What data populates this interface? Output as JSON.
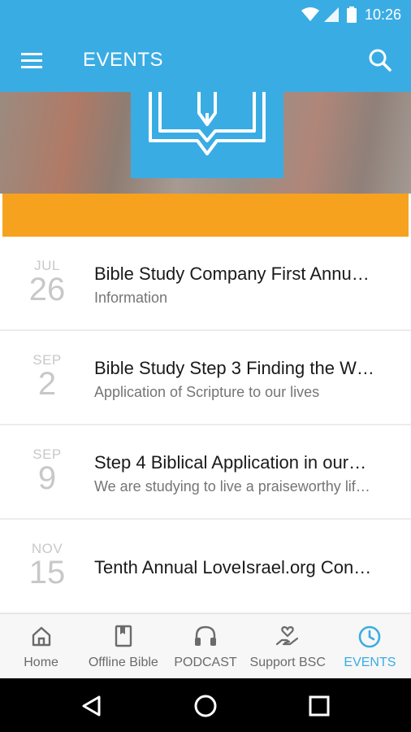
{
  "status_bar": {
    "time": "10:26"
  },
  "app_bar": {
    "title": "EVENTS"
  },
  "events": [
    {
      "month": "JUL",
      "day": "26",
      "title": "Bible Study Company First Annu…",
      "subtitle": "Information"
    },
    {
      "month": "SEP",
      "day": "2",
      "title": "Bible Study Step 3 Finding the W…",
      "subtitle": "Application of Scripture to our lives"
    },
    {
      "month": "SEP",
      "day": "9",
      "title": "Step 4 Biblical Application in our…",
      "subtitle": "We are studying to live a praiseworthy lif…"
    },
    {
      "month": "NOV",
      "day": "15",
      "title": "Tenth Annual LoveIsrael.org Con…",
      "subtitle": ""
    }
  ],
  "bottom_nav": [
    {
      "label": "Home",
      "icon": "home-icon"
    },
    {
      "label": "Offline Bible",
      "icon": "book-icon"
    },
    {
      "label": "PODCAST",
      "icon": "headphones-icon"
    },
    {
      "label": "Support BSC",
      "icon": "donate-icon"
    },
    {
      "label": "EVENTS",
      "icon": "clock-icon",
      "active": true
    }
  ],
  "colors": {
    "primary": "#3aace4",
    "accent": "#f6a21e"
  }
}
